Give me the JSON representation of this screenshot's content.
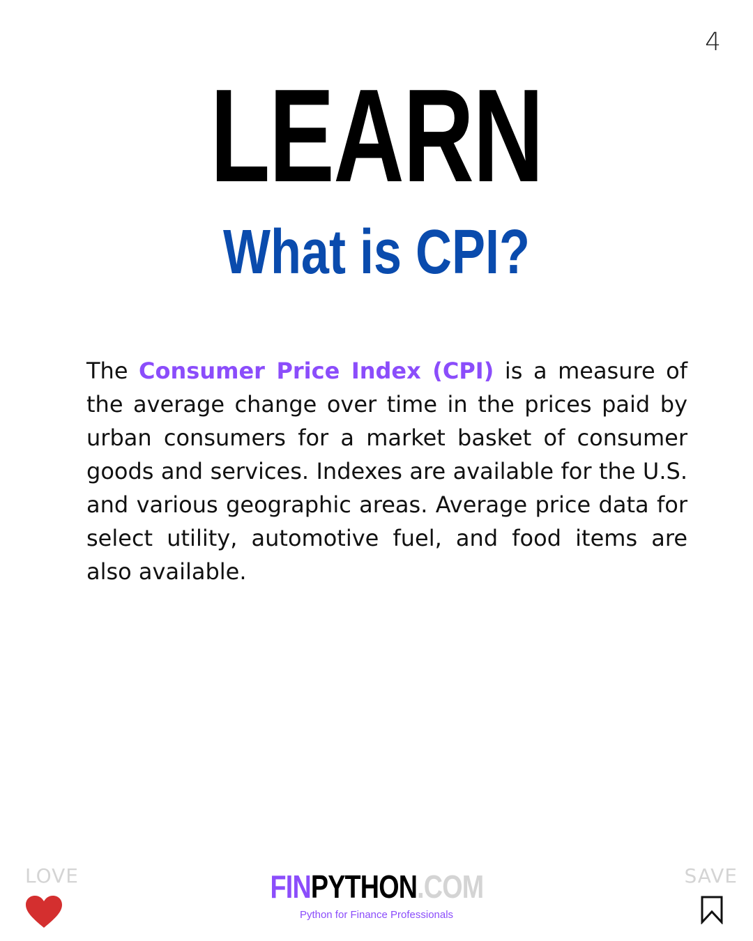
{
  "page_number": "4",
  "headline": "LEARN",
  "subheadline": "What is CPI?",
  "body": {
    "intro": "The ",
    "highlight": "Consumer Price Index (CPI)",
    "rest": " is a measure of the average change over time in the prices paid by urban consumers for a market basket of consumer goods and services. Indexes are available for the U.S. and various geographic areas. Average price data for select utility, automotive fuel, and food items are also available."
  },
  "footer": {
    "love_label": "LOVE",
    "save_label": "SAVE",
    "brand": {
      "fin": "FIN",
      "python": "PYTHON",
      "com": ".COM",
      "tagline": "Python for Finance Professionals"
    },
    "icons": {
      "love": "heart-icon",
      "save": "bookmark-icon"
    }
  },
  "colors": {
    "headline": "#000000",
    "subheadline": "#0a4bad",
    "highlight": "#8b4dfb",
    "heart": "#d42f2f",
    "muted": "#d4d4d4"
  }
}
